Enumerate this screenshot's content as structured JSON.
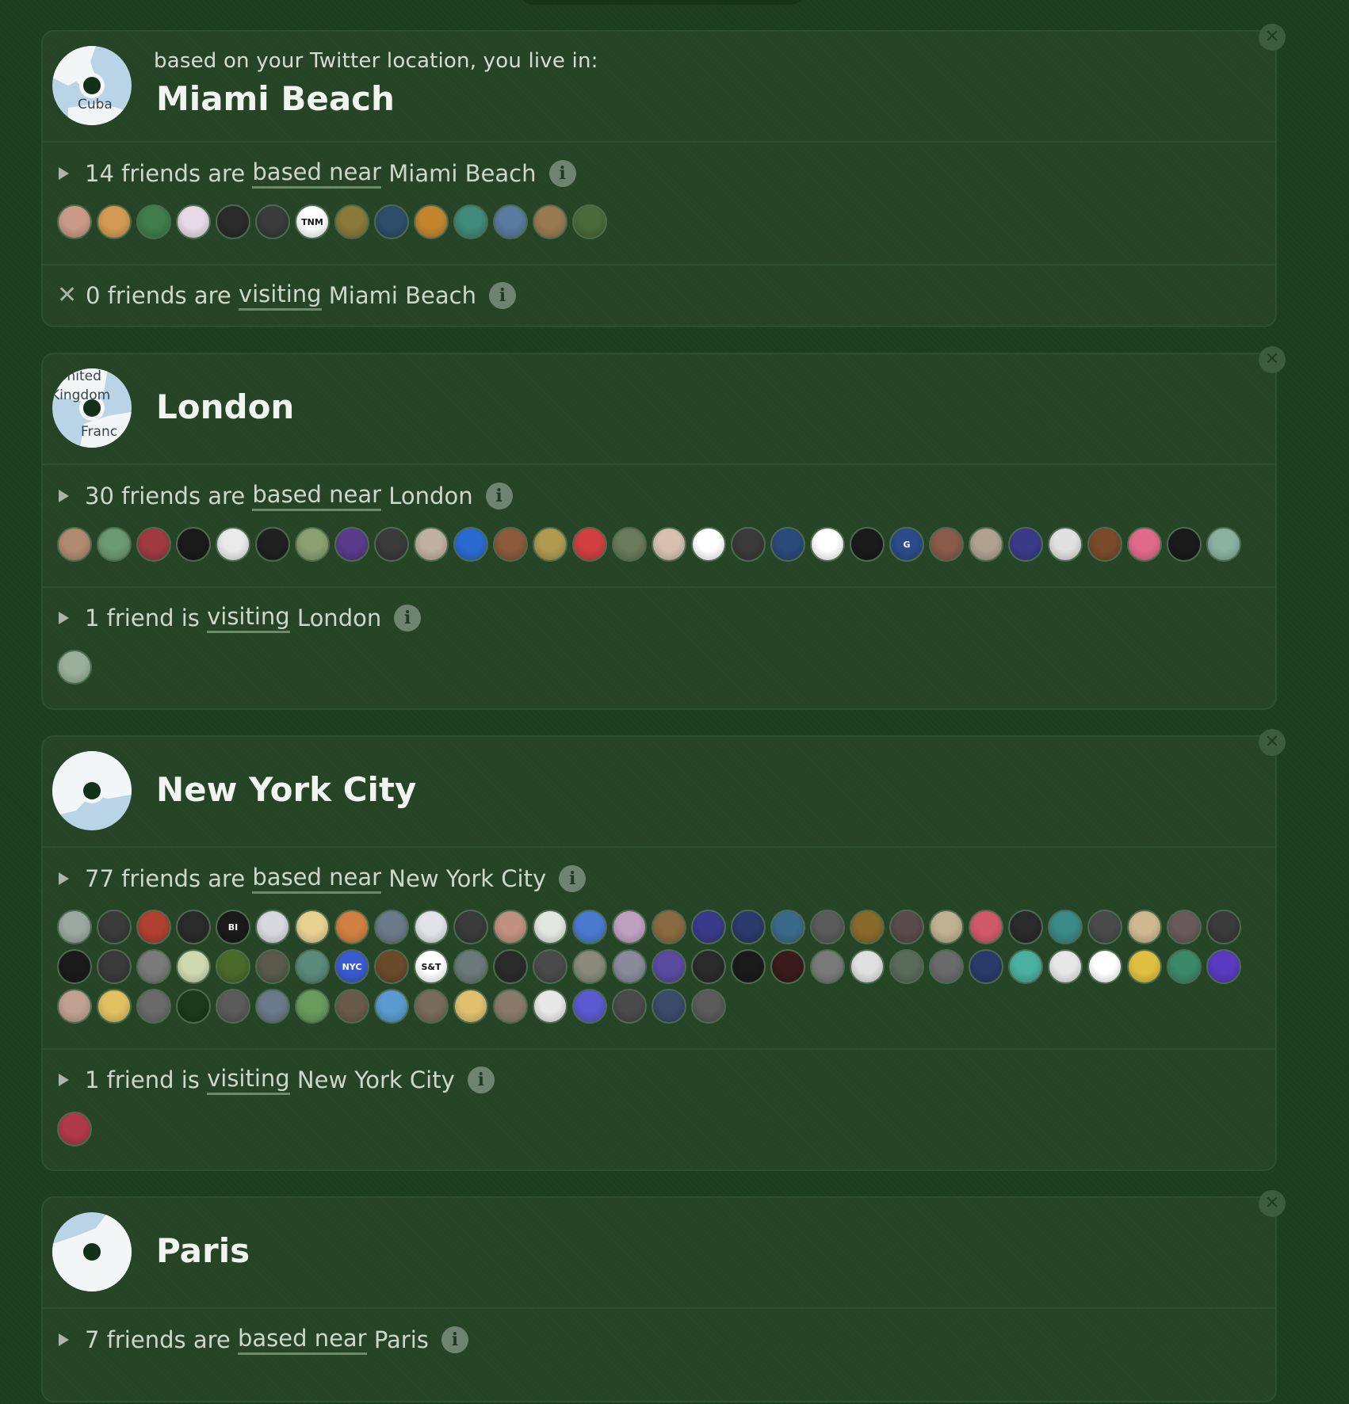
{
  "cards": [
    {
      "subtitle": "based on your Twitter location, you live in:",
      "city": "Miami Beach",
      "map_labels": [
        "Cuba"
      ],
      "based": {
        "prefix": "14 friends are",
        "link": "based near",
        "suffix": "Miami Beach",
        "expanded": true,
        "avatars": [
          "#c99b86",
          "#d49a53",
          "#3f7d4a",
          "#e7d9e8",
          "#2a2a2a",
          "#3a3a3a",
          "#ffffff",
          "#8a7a3a",
          "#2d4d6a",
          "#c2852e",
          "#3f8a7a",
          "#5a7aa0",
          "#9a7a50",
          "#4a6a3a"
        ],
        "avatar_text": {
          "6": "TNM"
        }
      },
      "visiting": {
        "prefix": "0 friends are",
        "link": "visiting",
        "suffix": "Miami Beach",
        "expanded": false,
        "avatars": []
      }
    },
    {
      "subtitle": "",
      "city": "London",
      "map_labels": [
        "United",
        "Kingdom",
        "Franc"
      ],
      "based": {
        "prefix": "30 friends are",
        "link": "based near",
        "suffix": "London",
        "expanded": true,
        "avatars": [
          "#b08a70",
          "#6a9a70",
          "#a03a40",
          "#1a1a1a",
          "#eaeaea",
          "#202020",
          "#8aa070",
          "#5a3a8a",
          "#3a3a3a",
          "#c0b0a0",
          "#2a6ad0",
          "#8a5a3a",
          "#b09a50",
          "#d04040",
          "#6a7a5a",
          "#d8c0b0",
          "#ffffff",
          "#3a3a3a",
          "#2a4a7a",
          "#ffffff",
          "#1a1a1a",
          "#2a4a8a",
          "#8a5a4a",
          "#b0a090",
          "#3a3a8a",
          "#e0e0e0",
          "#7a4a2a",
          "#e06a8a",
          "#1a1a1a",
          "#8ab0a0"
        ],
        "avatar_text": {
          "6": "",
          "20": "",
          "21": "G"
        }
      },
      "visiting": {
        "prefix": "1 friend is",
        "link": "visiting",
        "suffix": "London",
        "expanded": true,
        "avatars": [
          "#9ab09a"
        ],
        "avatar_text": {}
      }
    },
    {
      "subtitle": "",
      "city": "New York City",
      "map_labels": [],
      "based": {
        "prefix": "77 friends are",
        "link": "based near",
        "suffix": "New York City",
        "expanded": true,
        "avatars": [
          "#9aa8a0",
          "#3a3a3a",
          "#b04030",
          "#2a2a2a",
          "#1a1a1a",
          "#d8d8e0",
          "#e8d090",
          "#d08040",
          "#6a7a8a",
          "#e0e4e8",
          "#3a3a3a",
          "#c09080",
          "#e0e8e0",
          "#4a7ad0",
          "#c0a0c0",
          "#8a6a40",
          "#3a3a8a",
          "#2a3a6a",
          "#3a6a8a",
          "#5a5a5a",
          "#8a6a2a",
          "#5a4a4a",
          "#c0b090",
          "#d05a6a",
          "#2a2a2a",
          "#3a8a8a",
          "#4a4a4a",
          "#d0b890",
          "#6a5a5a",
          "#3a3a3a",
          "#1a1a1a",
          "#3a3a3a",
          "#7a7a7a",
          "#d0d8b0",
          "#4a6a2a",
          "#5a5a4a",
          "#5a8a7a",
          "#3a5ad0",
          "#6a4a2a",
          "#ffffff",
          "#6a7a7a",
          "#2a2a2a",
          "#4a4a4a",
          "#8a8a7a",
          "#8a8a9a",
          "#5a4aa0",
          "#2a2a2a",
          "#1a1a1a",
          "#3a1a1a",
          "#7a7a7a",
          "#e0e0e0",
          "#5a6a5a",
          "#6a6a6a",
          "#2a3a6a",
          "#4ab0a0",
          "#e8e8e8",
          "#ffffff",
          "#e0c040",
          "#3a8a6a",
          "#5a3ac0",
          "#c0a090",
          "#e0c060",
          "#6a6a6a",
          "#1a3a1a",
          "#5a5a5a",
          "#6a7a8a",
          "#6a9a5a",
          "#6a5a4a",
          "#5a9ad0",
          "#7a6a5a",
          "#e0c070",
          "#8a7a6a",
          "#e8e8e8",
          "#5a5ad0",
          "#4a4a4a",
          "#3a4a6a",
          "#5a5a5a"
        ],
        "avatar_text": {
          "4": "BI",
          "37": "NYC",
          "39": "S&T"
        }
      },
      "visiting": {
        "prefix": "1 friend is",
        "link": "visiting",
        "suffix": "New York City",
        "expanded": true,
        "avatars": [
          "#b03a4a"
        ],
        "avatar_text": {}
      }
    },
    {
      "subtitle": "",
      "city": "Paris",
      "map_labels": [],
      "based": {
        "prefix": "7 friends are",
        "link": "based near",
        "suffix": "Paris",
        "expanded": false,
        "avatars": [],
        "avatar_text": {}
      },
      "visiting": null
    }
  ],
  "icons": {
    "close": "close-icon",
    "info": "info-icon",
    "caret": "caret-right-icon",
    "x": "x-icon"
  },
  "colors": {
    "background": "#1d3d20",
    "card_border": "#2c5131",
    "map_water": "#b9d4e6",
    "map_land": "#f3f6f7"
  }
}
